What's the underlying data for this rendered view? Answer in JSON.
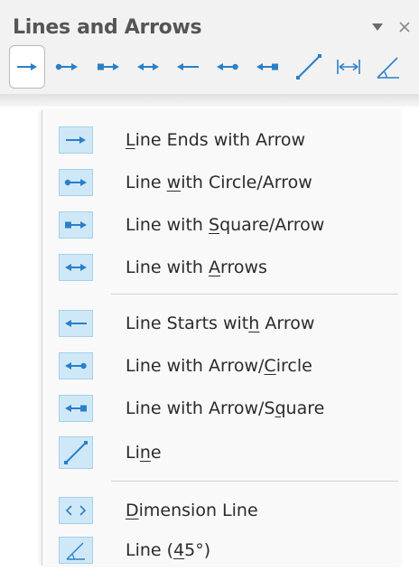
{
  "toolbar": {
    "title": "Lines and Arrows",
    "buttons": [
      {
        "icon": "line-ends-with-arrow-icon",
        "active": true
      },
      {
        "icon": "line-with-circle-arrow-icon"
      },
      {
        "icon": "line-with-square-arrow-icon"
      },
      {
        "icon": "line-with-arrows-icon"
      },
      {
        "icon": "line-starts-with-arrow-icon"
      },
      {
        "icon": "line-with-arrow-circle-icon"
      },
      {
        "icon": "line-with-arrow-square-icon"
      },
      {
        "icon": "line-icon"
      },
      {
        "icon": "dimension-line-icon"
      },
      {
        "icon": "line-45-icon"
      }
    ]
  },
  "menu": {
    "items": [
      {
        "pre": "",
        "key": "L",
        "post": "ine Ends with Arrow",
        "icon": "line-ends-with-arrow-icon"
      },
      {
        "pre": "Line ",
        "key": "w",
        "post": "ith Circle/Arrow",
        "icon": "line-with-circle-arrow-icon"
      },
      {
        "pre": "Line with ",
        "key": "S",
        "post": "quare/Arrow",
        "icon": "line-with-square-arrow-icon"
      },
      {
        "pre": "Line with ",
        "key": "A",
        "post": "rrows",
        "icon": "line-with-arrows-icon"
      },
      {
        "pre": "Line Starts wit",
        "key": "h",
        "post": " Arrow",
        "icon": "line-starts-with-arrow-icon"
      },
      {
        "pre": "Line with Arrow/",
        "key": "C",
        "post": "ircle",
        "icon": "line-with-arrow-circle-icon"
      },
      {
        "pre": "Line with Arrow/S",
        "key": "q",
        "post": "uare",
        "icon": "line-with-arrow-square-icon"
      },
      {
        "pre": "Li",
        "key": "n",
        "post": "e",
        "icon": "line-icon"
      },
      {
        "pre": "",
        "key": "D",
        "post": "imension Line",
        "icon": "dimension-line-icon"
      },
      {
        "pre": "Line (",
        "key": "4",
        "post": "5°)",
        "icon": "line-45-icon"
      }
    ]
  },
  "colors": {
    "icon_blue": "#2a7fc8",
    "icon_bg": "#cfe8f7",
    "icon_border": "#a6d0ea"
  }
}
